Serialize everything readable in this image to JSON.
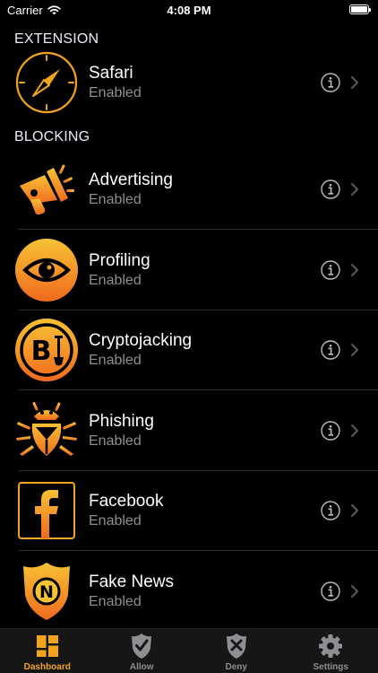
{
  "status_bar": {
    "carrier": "Carrier",
    "time": "4:08 PM"
  },
  "sections": {
    "extension": "EXTENSION",
    "blocking": "BLOCKING"
  },
  "rows": [
    {
      "title": "Safari",
      "subtitle": "Enabled",
      "icon": "compass-icon"
    },
    {
      "title": "Advertising",
      "subtitle": "Enabled",
      "icon": "megaphone-icon"
    },
    {
      "title": "Profiling",
      "subtitle": "Enabled",
      "icon": "eye-icon"
    },
    {
      "title": "Cryptojacking",
      "subtitle": "Enabled",
      "icon": "bitcoin-icon"
    },
    {
      "title": "Phishing",
      "subtitle": "Enabled",
      "icon": "bug-icon"
    },
    {
      "title": "Facebook",
      "subtitle": "Enabled",
      "icon": "facebook-icon"
    },
    {
      "title": "Fake News",
      "subtitle": "Enabled",
      "icon": "shield-n-icon"
    }
  ],
  "tabs": [
    {
      "label": "Dashboard",
      "icon": "dashboard-grid-icon",
      "active": true
    },
    {
      "label": "Allow",
      "icon": "shield-check-icon",
      "active": false
    },
    {
      "label": "Deny",
      "icon": "shield-x-icon",
      "active": false
    },
    {
      "label": "Settings",
      "icon": "gear-icon",
      "active": false
    }
  ],
  "colors": {
    "accent": "#f2a51c",
    "gradient_start": "#f7c233",
    "gradient_end": "#f06a1e",
    "background": "#000000"
  }
}
